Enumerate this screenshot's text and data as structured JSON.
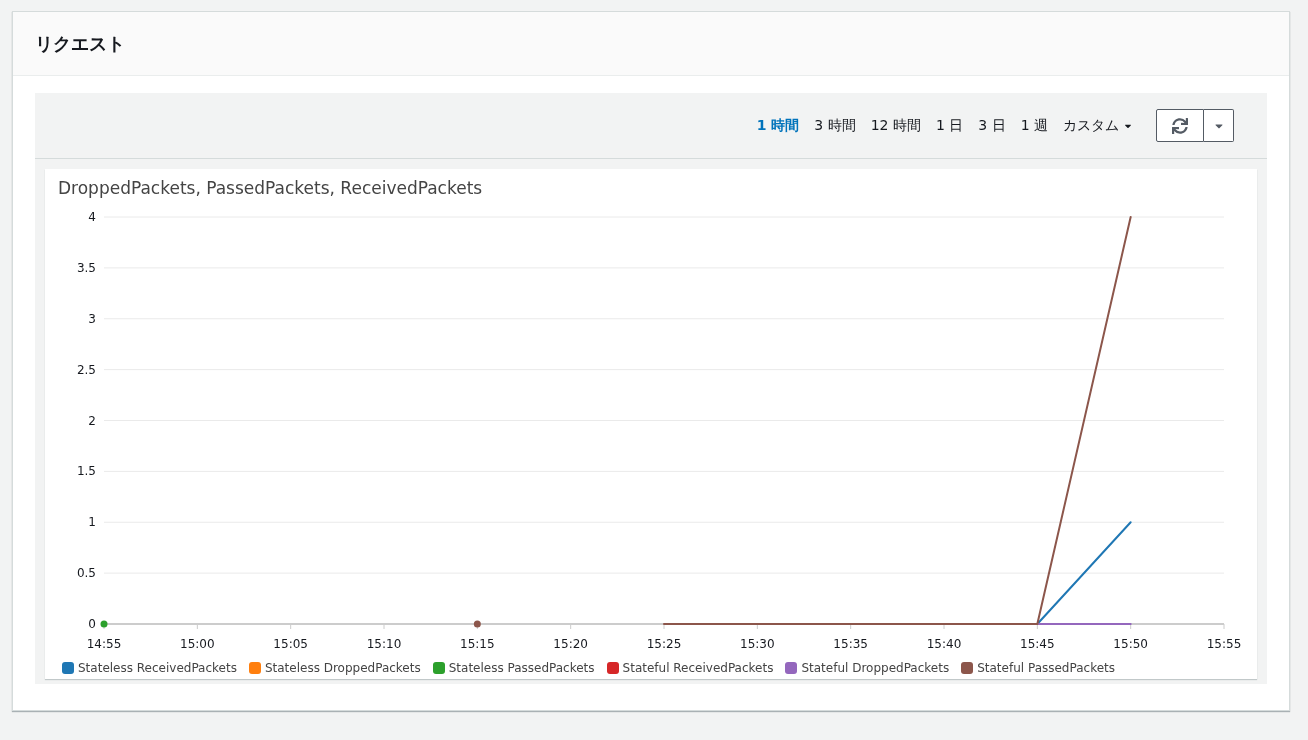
{
  "panel": {
    "title": "リクエスト"
  },
  "time_ranges": [
    {
      "label": "1 時間",
      "selected": true
    },
    {
      "label": "3 時間",
      "selected": false
    },
    {
      "label": "12 時間",
      "selected": false
    },
    {
      "label": "1 日",
      "selected": false
    },
    {
      "label": "3 日",
      "selected": false
    },
    {
      "label": "1 週",
      "selected": false
    }
  ],
  "custom_range": {
    "label": "カスタム"
  },
  "widget": {
    "title": "DroppedPackets, PassedPackets, ReceivedPackets",
    "chart_data": {
      "type": "line",
      "grid": true,
      "categories": [
        "14:55",
        "15:00",
        "15:05",
        "15:10",
        "15:15",
        "15:20",
        "15:25",
        "15:30",
        "15:35",
        "15:40",
        "15:45",
        "15:50",
        "15:55"
      ],
      "ylim": [
        0,
        4
      ],
      "yticks": [
        0,
        0.5,
        1,
        1.5,
        2,
        2.5,
        3,
        3.5,
        4
      ],
      "series": [
        {
          "name": "Stateless ReceivedPackets",
          "color": "#1f77b4",
          "values": [
            null,
            null,
            null,
            null,
            null,
            null,
            null,
            null,
            null,
            null,
            0,
            1,
            null
          ]
        },
        {
          "name": "Stateless DroppedPackets",
          "color": "#ff7f0e",
          "values": [
            null,
            null,
            null,
            null,
            null,
            null,
            null,
            null,
            null,
            null,
            null,
            null,
            null
          ]
        },
        {
          "name": "Stateless PassedPackets",
          "color": "#2ca02c",
          "marker": true,
          "values": [
            0,
            null,
            null,
            null,
            null,
            null,
            null,
            null,
            null,
            null,
            null,
            null,
            null
          ]
        },
        {
          "name": "Stateful ReceivedPackets",
          "color": "#d62728",
          "values": [
            null,
            null,
            null,
            null,
            null,
            null,
            null,
            null,
            null,
            null,
            null,
            null,
            null
          ]
        },
        {
          "name": "Stateful DroppedPackets",
          "color": "#9467bd",
          "values": [
            null,
            null,
            null,
            null,
            null,
            null,
            null,
            null,
            null,
            null,
            0,
            0,
            null
          ]
        },
        {
          "name": "Stateful PassedPackets",
          "color": "#8c564b",
          "marker": true,
          "values": [
            null,
            null,
            null,
            null,
            0,
            null,
            0,
            0,
            0,
            0,
            0,
            4,
            null
          ]
        }
      ]
    }
  }
}
